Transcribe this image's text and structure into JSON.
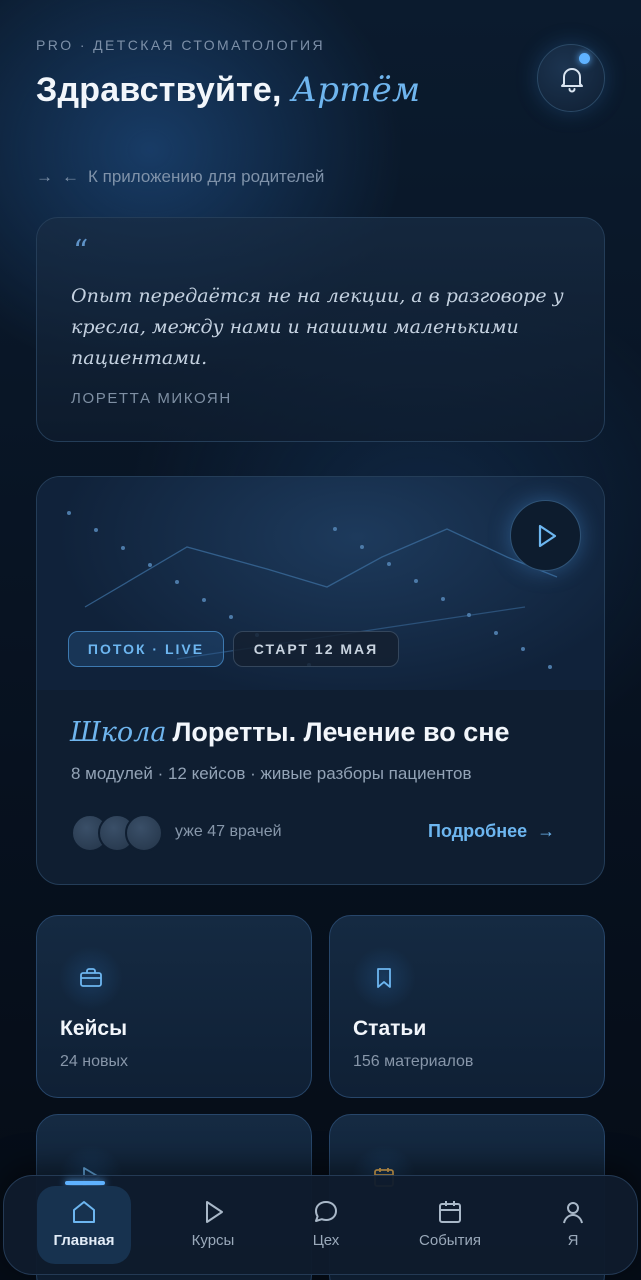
{
  "header": {
    "eyebrow": "PRO · ДЕТСКАЯ СТОМАТОЛОГИЯ",
    "greeting": "Здравствуйте,",
    "user_name": "Артём",
    "has_notification": true
  },
  "parent_link": {
    "arrow": "→",
    "back_arrow": "←",
    "label": "К приложению для родителей"
  },
  "quote": {
    "mark": "“",
    "text": "Опыт передаётся не на лекции, а в разговоре у кресла, между нами и нашими маленькими пациентами.",
    "author": "ЛОРЕТТА МИКОЯН"
  },
  "course": {
    "chip_live": "ПОТОК · LIVE",
    "chip_start": "СТАРТ 12 МАЯ",
    "title_accent": "Школа",
    "title_rest": "Лоретты. Лечение во сне",
    "subtitle": "8 модулей · 12 кейсов · живые разборы пациентов",
    "doctors": "уже 47 врачей",
    "more_label": "Подробнее",
    "more_arrow": "→"
  },
  "tiles": [
    {
      "title": "Кейсы",
      "subtitle": "24 новых",
      "icon": "briefcase-icon"
    },
    {
      "title": "Статьи",
      "subtitle": "156 материалов",
      "icon": "bookmark-icon"
    },
    {
      "title": "",
      "subtitle": "",
      "icon": "play-icon"
    },
    {
      "title": "",
      "subtitle": "",
      "icon": "calendar-icon"
    }
  ],
  "nav": {
    "items": [
      {
        "label": "Главная",
        "icon": "home-icon",
        "active": true
      },
      {
        "label": "Курсы",
        "icon": "play-icon",
        "active": false
      },
      {
        "label": "Цех",
        "icon": "chat-icon",
        "active": false
      },
      {
        "label": "События",
        "icon": "calendar-icon",
        "active": false
      },
      {
        "label": "Я",
        "icon": "user-icon",
        "active": false
      }
    ]
  },
  "colors": {
    "accent": "#6db6f0",
    "background": "#07111f",
    "calendar_accent": "#e8b25a"
  }
}
